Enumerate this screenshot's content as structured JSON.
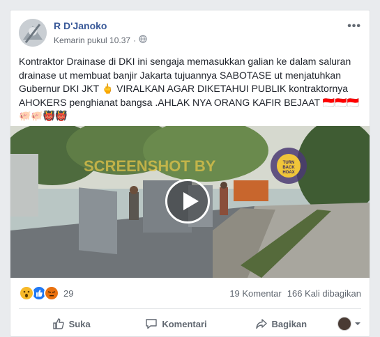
{
  "post": {
    "author": "R D'Janoko",
    "timestamp": "Kemarin pukul 10.37",
    "audience_icon": "globe-icon",
    "more_label": "•••",
    "text": "Kontraktor Drainase di DKI ini sengaja memasukkan galian ke dalam saluran drainase ut membuat banjir Jakarta tujuannya SABOTASE ut menjatuhkan Gubernur DKI JKT 🖕 VIRALKAN AGAR DIKETAHUI PUBLIK kontraktornya AHOKERS penghianat bangsa .AHLAK NYA ORANG KAFIR BEJAAT 🇮🇩🇮🇩🇮🇩 🐖🐖👹👹"
  },
  "media": {
    "watermark": "SCREENSHOT BY",
    "logo_text": "TURN BACK HOAX",
    "play_icon": "play-icon"
  },
  "stats": {
    "reaction_count": "29",
    "comments": "19 Komentar",
    "shares": "166 Kali dibagikan",
    "reactions": [
      "wow",
      "like",
      "angry"
    ]
  },
  "actions": {
    "like": "Suka",
    "comment": "Komentari",
    "share": "Bagikan"
  },
  "colors": {
    "link": "#385898",
    "like_blue": "#2078f4",
    "angry": "#e9710f",
    "wow": "#f7b928"
  }
}
